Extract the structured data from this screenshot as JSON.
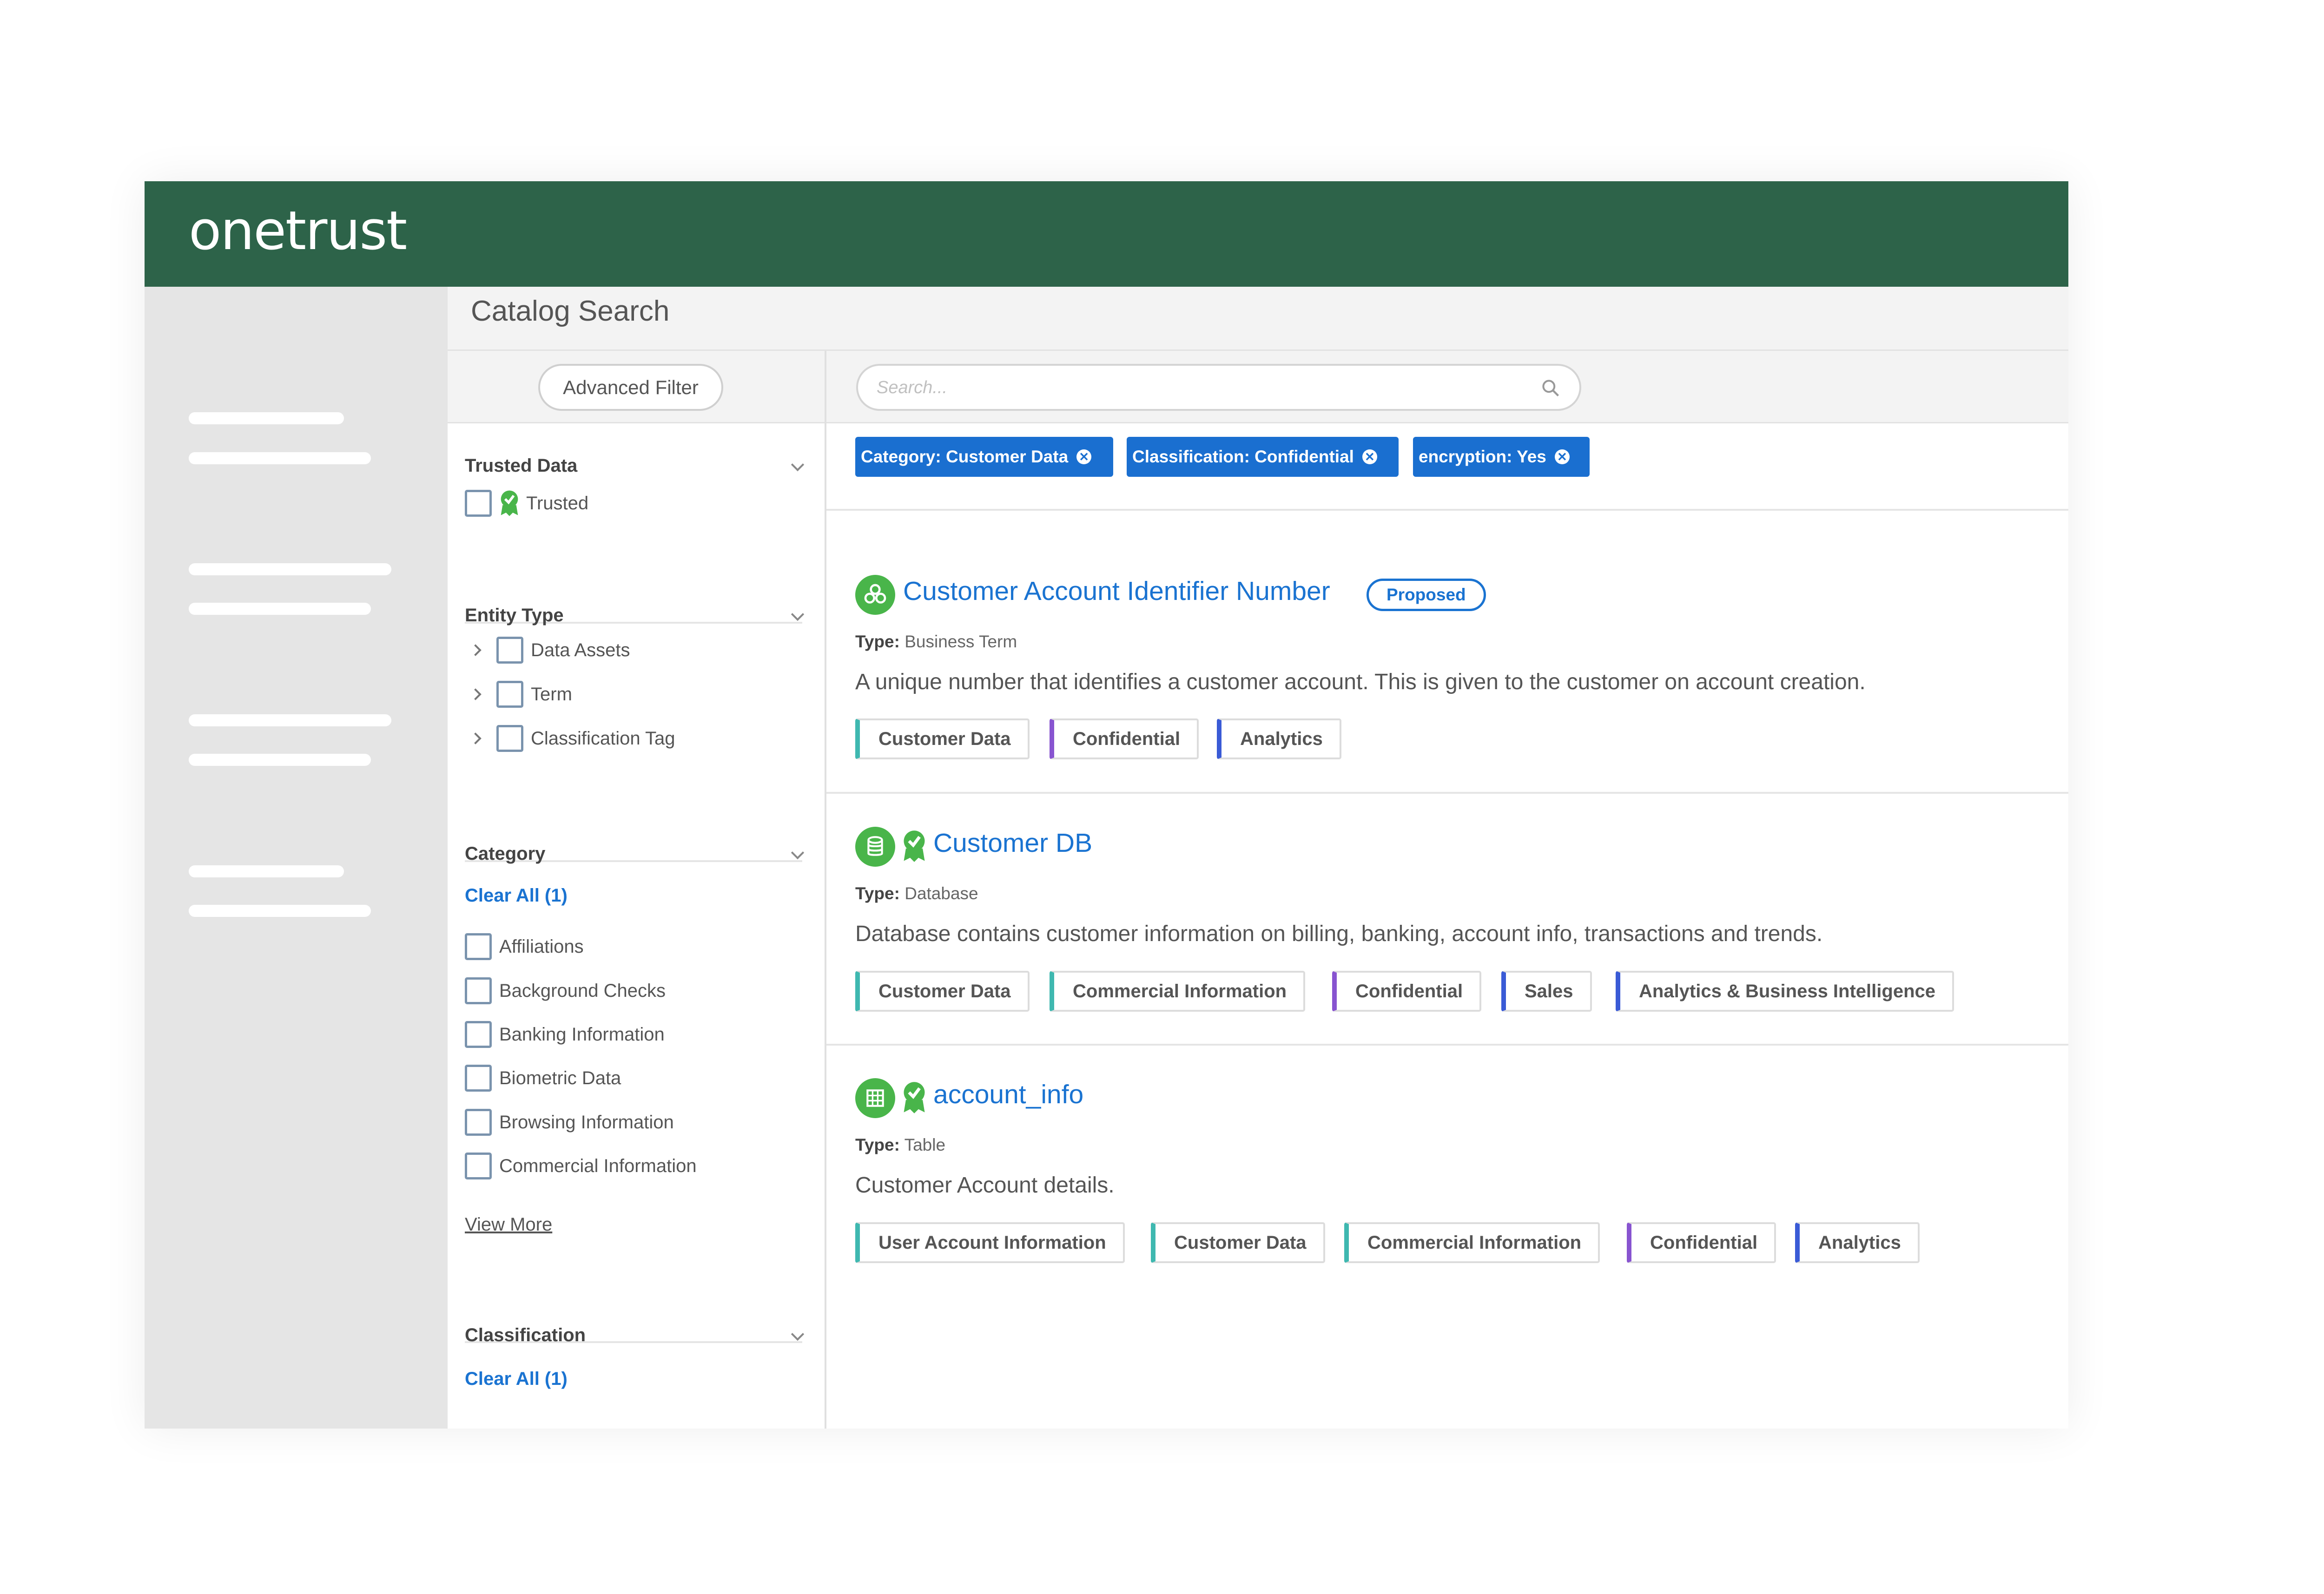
{
  "header": {
    "logo": "onetrust"
  },
  "colors": {
    "header_bg": "#2d6349",
    "accent": "#1a73d1",
    "chip_bg": "#1a6fd0",
    "icon_green": "#49b54a",
    "tag_teal": "#3fb8b0",
    "tag_purple": "#8854d0",
    "tag_blue": "#3a5bd6"
  },
  "page": {
    "title": "Catalog Search"
  },
  "filters": {
    "advanced_filter_label": "Advanced Filter",
    "trusted": {
      "heading": "Trusted Data",
      "option": "Trusted"
    },
    "entity_type": {
      "heading": "Entity Type",
      "options": [
        "Data Assets",
        "Term",
        "Classification Tag"
      ]
    },
    "category": {
      "heading": "Category",
      "clear_all": "Clear All (1)",
      "options": [
        "Affiliations",
        "Background Checks",
        "Banking Information",
        "Biometric Data",
        "Browsing Information",
        "Commercial Information"
      ],
      "view_more": "View More"
    },
    "classification": {
      "heading": "Classification",
      "clear_all": "Clear All (1)"
    }
  },
  "search": {
    "placeholder": "Search..."
  },
  "active_filters": [
    "Category: Customer Data",
    "Classification: Confidential",
    "encryption: Yes"
  ],
  "results": [
    {
      "title": "Customer Account Identifier Number",
      "status": "Proposed",
      "icon": "business-term-icon",
      "trusted": false,
      "type_label": "Type:",
      "type_value": "Business Term",
      "description": "A unique number that identifies a customer account. This is given to the customer on account creation.",
      "tags": [
        "Customer Data",
        "Confidential",
        "Analytics"
      ]
    },
    {
      "title": "Customer DB",
      "icon": "database-icon",
      "trusted": true,
      "type_label": "Type:",
      "type_value": "Database",
      "description": "Database contains customer information on billing, banking, account info, transactions and trends.",
      "tags": [
        "Customer Data",
        "Commercial Information",
        "Confidential",
        "Sales",
        "Analytics & Business Intelligence"
      ]
    },
    {
      "title": "account_info",
      "icon": "table-icon",
      "trusted": true,
      "type_label": "Type:",
      "type_value": "Table",
      "description": "Customer Account details.",
      "tags": [
        "User Account Information",
        "Customer Data",
        "Commercial Information",
        "Confidential",
        "Analytics"
      ]
    }
  ]
}
